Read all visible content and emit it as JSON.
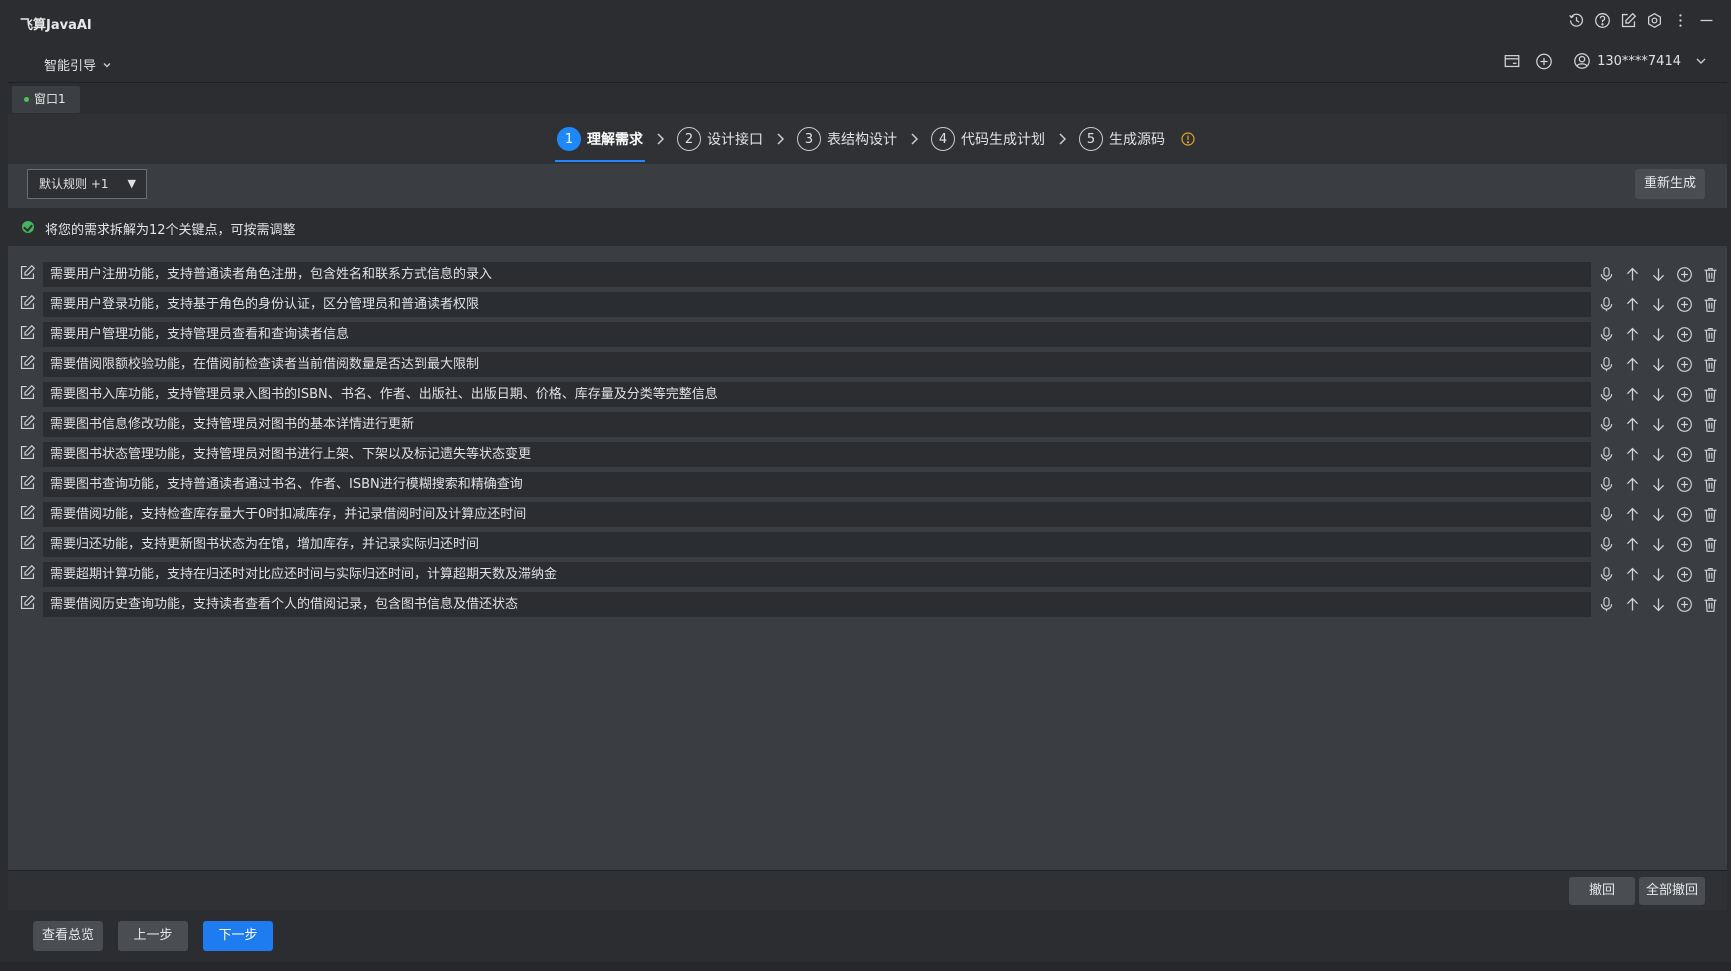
{
  "app": {
    "title": "飞算JavaAI"
  },
  "toolbar": {
    "guide_label": "智能引导",
    "user_phone": "130****7414"
  },
  "tabs": [
    {
      "label": "窗口1"
    }
  ],
  "steps": [
    {
      "num": "1",
      "label": "理解需求",
      "active": true
    },
    {
      "num": "2",
      "label": "设计接口",
      "active": false
    },
    {
      "num": "3",
      "label": "表结构设计",
      "active": false
    },
    {
      "num": "4",
      "label": "代码生成计划",
      "active": false
    },
    {
      "num": "5",
      "label": "生成源码",
      "active": false
    }
  ],
  "rules": {
    "selected": "默认规则 +1",
    "regenerate_label": "重新生成"
  },
  "notice": {
    "text": "将您的需求拆解为12个关键点，可按需调整",
    "status_color": "#46b45a"
  },
  "requirements": [
    "需要用户注册功能，支持普通读者角色注册，包含姓名和联系方式信息的录入",
    "需要用户登录功能，支持基于角色的身份认证，区分管理员和普通读者权限",
    "需要用户管理功能，支持管理员查看和查询读者信息",
    "需要借阅限额校验功能，在借阅前检查读者当前借阅数量是否达到最大限制",
    "需要图书入库功能，支持管理员录入图书的ISBN、书名、作者、出版社、出版日期、价格、库存量及分类等完整信息",
    "需要图书信息修改功能，支持管理员对图书的基本详情进行更新",
    "需要图书状态管理功能，支持管理员对图书进行上架、下架以及标记遗失等状态变更",
    "需要图书查询功能，支持普通读者通过书名、作者、ISBN进行模糊搜索和精确查询",
    "需要借阅功能，支持检查库存量大于0时扣减库存，并记录借阅时间及计算应还时间",
    "需要归还功能，支持更新图书状态为在馆，增加库存，并记录实际归还时间",
    "需要超期计算功能，支持在归还时对比应还时间与实际归还时间，计算超期天数及滞纳金",
    "需要借阅历史查询功能，支持读者查看个人的借阅记录，包含图书信息及借还状态"
  ],
  "undo": {
    "undo_label": "撤回",
    "undo_all_label": "全部撤回"
  },
  "footer": {
    "overview_label": "查看总览",
    "prev_label": "上一步",
    "next_label": "下一步"
  },
  "colors": {
    "accent": "#1e88ff",
    "success": "#46b45a",
    "warning": "#e0a526"
  }
}
